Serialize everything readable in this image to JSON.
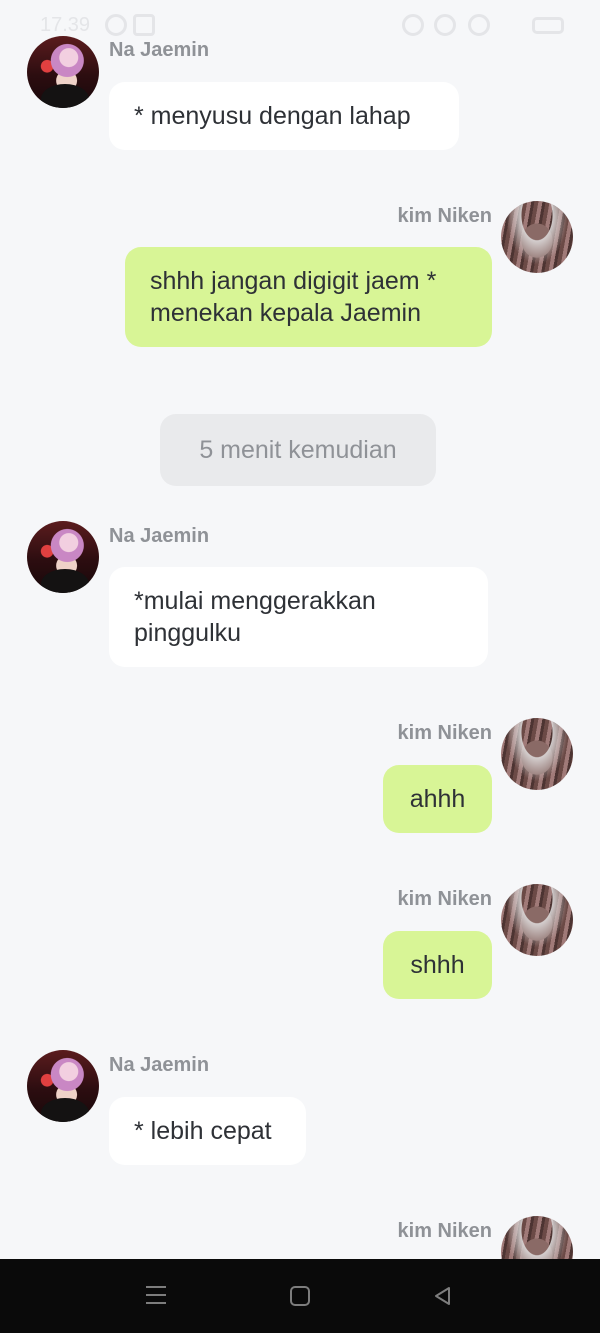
{
  "status_bar": {
    "time": "17.39"
  },
  "messages": [
    {
      "sender": "Na Jaemin",
      "text": "* menyusu dengan lahap"
    },
    {
      "sender": "kim Niken",
      "line1": "shhh jangan digigit jaem *",
      "line2": "menekan kepala Jaemin"
    },
    {
      "text": "5 menit kemudian"
    },
    {
      "sender": "Na Jaemin",
      "line1": "*mulai menggerakkan",
      "line2": "pinggulku"
    },
    {
      "sender": "kim Niken",
      "text": "ahhh"
    },
    {
      "sender": "kim Niken",
      "text": "shhh"
    },
    {
      "sender": "Na Jaemin",
      "text": "* lebih cepat"
    },
    {
      "sender": "kim Niken"
    }
  ],
  "icons": {
    "avatar_jaemin": "avatar-na-jaemin",
    "avatar_niken": "avatar-kim-niken",
    "nav_menu": "menu-icon",
    "nav_home": "home-icon",
    "nav_back": "back-icon"
  },
  "colors": {
    "background": "#f6f7f9",
    "incoming_bubble": "#ffffff",
    "outgoing_bubble": "#d8f596",
    "divider": "#e9eaec",
    "name_text": "#8f9297",
    "nav_bar": "#0a0a0a"
  }
}
